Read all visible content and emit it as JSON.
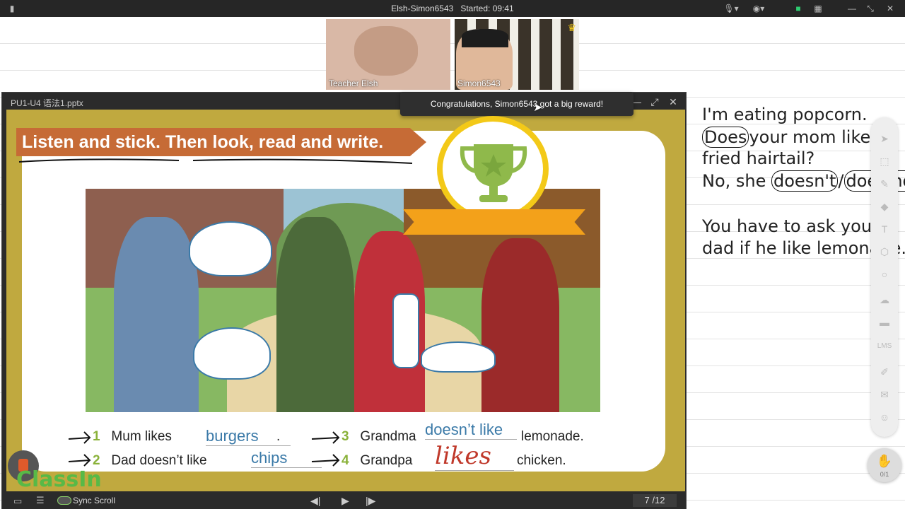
{
  "topbar": {
    "title": "Elsh-Simon6543",
    "started": "Started: 09:41"
  },
  "videos": {
    "teacher": "Teacher Elsh",
    "student": "Simon6543"
  },
  "toast": "Congratulations, Simon6543 got a big reward!",
  "ppt": {
    "title": "PU1-U4 语法1.pptx",
    "page": "7",
    "total": "/12",
    "sync": "Sync Scroll"
  },
  "slide": {
    "instruction": "Listen and stick. Then look, read and write.",
    "exercises": [
      {
        "num": "1",
        "before": "Mum likes",
        "answer": "burgers",
        "after": "."
      },
      {
        "num": "2",
        "before": "Dad doesn’t like",
        "answer": "chips",
        "after": ""
      },
      {
        "num": "3",
        "before": "Grandma",
        "answer": "doesn’t like",
        "after": "lemonade."
      },
      {
        "num": "4",
        "before": "Grandpa",
        "answer": "likes",
        "after": "chicken."
      }
    ]
  },
  "logo": "ClassIn",
  "notes": {
    "line1": "I'm eating popcorn.",
    "line2a": "Does",
    "line2b": "your mom like",
    "line3": "fried hairtail?",
    "line4a": "No, she",
    "line4b": "doesn't",
    "line4c": "/",
    "line4d": "does not",
    "line5": "You have to ask your",
    "line6": "dad if he like lemonade."
  },
  "toolbar": {
    "lms": "LMS",
    "hand_count": "0/1"
  }
}
